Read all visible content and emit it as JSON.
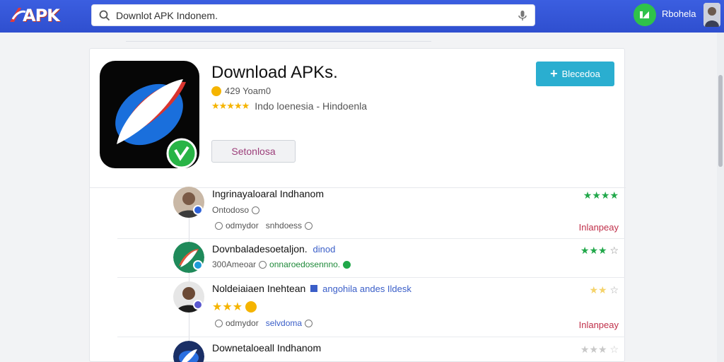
{
  "header": {
    "logo_text": "APK",
    "search": {
      "value": "Downlot APK Indonem."
    },
    "user_name": "Rbohela"
  },
  "app": {
    "title": "Download APKs.",
    "downloads": "429 Yoam0",
    "rating_stars": "★★★★★",
    "region": "Indo loenesia  -  Hindoenla",
    "secondary_button": "Setonlosa",
    "primary_button": "Blecedoa"
  },
  "rows": [
    {
      "title": "Ingrinayaloaral Indhanom",
      "tag": "",
      "line1": "Ontodoso",
      "line2_a": "odmydor",
      "line2_b": "snhdoess",
      "stars": "★★★★",
      "label": "Inlanpeay"
    },
    {
      "title": "Dovnbaladesoetaljon.",
      "tag": "dinod",
      "line1_a": "300Ameoar",
      "line1_b": "onnaroedosennno."
    },
    {
      "title": "Noldeiaiaen Inehtean",
      "tag": "angohila andes Ildesk",
      "stars_hint": "★★★",
      "line2_a": "odmydor",
      "line2_b": "selvdoma",
      "label": "Inlanpeay"
    },
    {
      "title": "Downetaloeall Indhanom"
    }
  ],
  "colors": {
    "header_bg": "#2f4fcf",
    "primary": "#2aaed0",
    "star": "#f5b400",
    "green_star": "#21a84a",
    "label_red": "#c0304a"
  }
}
